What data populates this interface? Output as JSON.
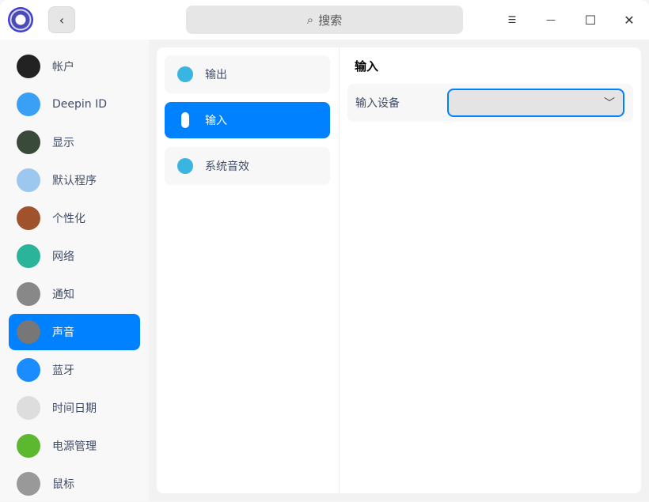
{
  "titlebar": {
    "search_placeholder": "搜索",
    "back_icon": "‹",
    "search_icon": "⌕",
    "menu_icon": "☰",
    "minimize_icon": "—",
    "maximize_icon": "☐",
    "close_icon": "✕"
  },
  "sidebar": {
    "items": [
      {
        "label": "帐户",
        "color": "#222"
      },
      {
        "label": "Deepin ID",
        "color": "#3aa0f5"
      },
      {
        "label": "显示",
        "color": "#3a4a3a"
      },
      {
        "label": "默认程序",
        "color": "#9cc8f0"
      },
      {
        "label": "个性化",
        "color": "#a0522d"
      },
      {
        "label": "网络",
        "color": "#2ab59a"
      },
      {
        "label": "通知",
        "color": "#888"
      },
      {
        "label": "声音",
        "color": "#777"
      },
      {
        "label": "蓝牙",
        "color": "#1a8cff"
      },
      {
        "label": "时间日期",
        "color": "#ddd"
      },
      {
        "label": "电源管理",
        "color": "#5cb82e"
      },
      {
        "label": "鼠标",
        "color": "#999"
      }
    ],
    "active_index": 7
  },
  "sound_menu": {
    "items": [
      {
        "label": "输出"
      },
      {
        "label": "输入"
      },
      {
        "label": "系统音效"
      }
    ],
    "active_index": 1
  },
  "content": {
    "title": "输入",
    "input_device_label": "输入设备",
    "input_device_value": ""
  },
  "colors": {
    "accent": "#0081ff"
  }
}
